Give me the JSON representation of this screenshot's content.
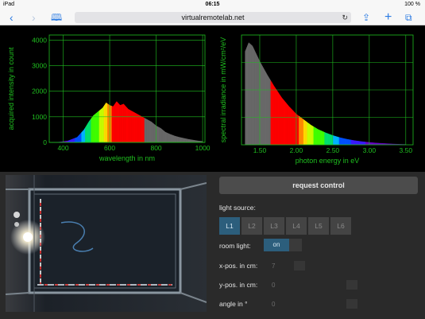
{
  "statusbar": {
    "device": "iPad",
    "wifi_icon": "wifi-icon",
    "time": "06:15",
    "battery": "100 %"
  },
  "browser": {
    "url": "virtualremotelab.net"
  },
  "chart_data": [
    {
      "type": "area",
      "xlabel": "wavelength in nm",
      "ylabel": "acquired intensity in count",
      "xlim": [
        340,
        1010
      ],
      "ylim": [
        0,
        4200
      ],
      "xticks": [
        "400",
        "600",
        "800",
        "1000"
      ],
      "yticks": [
        "0",
        "1000",
        "2000",
        "3000",
        "4000"
      ],
      "grid": true,
      "x": [
        350,
        380,
        420,
        460,
        490,
        510,
        530,
        550,
        570,
        585,
        600,
        615,
        630,
        645,
        660,
        680,
        700,
        720,
        740,
        760,
        780,
        800,
        820,
        840,
        860,
        880,
        900,
        920,
        940,
        960,
        980,
        1000
      ],
      "values": [
        0,
        10,
        60,
        200,
        500,
        800,
        1050,
        1200,
        1350,
        1550,
        1450,
        1400,
        1600,
        1450,
        1500,
        1300,
        1200,
        1100,
        1000,
        900,
        800,
        650,
        550,
        400,
        320,
        250,
        200,
        160,
        120,
        90,
        60,
        40
      ]
    },
    {
      "type": "area",
      "xlabel": "photon energy in eV",
      "ylabel": "spectral irradiance in mW/cm²/eV",
      "xlim": [
        1.25,
        3.6
      ],
      "ylim": [
        0,
        1
      ],
      "xticks": [
        "1.50",
        "2.00",
        "2.50",
        "3.00",
        "3.50"
      ],
      "grid": true,
      "x": [
        1.3,
        1.35,
        1.4,
        1.45,
        1.5,
        1.6,
        1.7,
        1.8,
        1.9,
        2.0,
        2.1,
        2.2,
        2.3,
        2.4,
        2.5,
        2.6,
        2.7,
        2.8,
        2.9,
        3.0,
        3.1,
        3.2,
        3.3,
        3.4,
        3.5
      ],
      "values": [
        0.85,
        0.93,
        0.9,
        0.83,
        0.76,
        0.64,
        0.53,
        0.43,
        0.35,
        0.28,
        0.23,
        0.18,
        0.14,
        0.11,
        0.085,
        0.065,
        0.05,
        0.038,
        0.029,
        0.022,
        0.016,
        0.012,
        0.008,
        0.005,
        0.003
      ]
    }
  ],
  "controls": {
    "request_label": "request control",
    "light_source_label": "light source:",
    "light_sources": [
      "L1",
      "L2",
      "L3",
      "L4",
      "L5",
      "L6"
    ],
    "active_source": "L1",
    "room_light_label": "room light:",
    "room_light_value": "on",
    "xpos_label": "x-pos. in cm:",
    "xpos_value": "7",
    "ypos_label": "y-pos. in cm:",
    "ypos_value": "0",
    "angle_label": "angle in °",
    "angle_value": "0"
  },
  "colors": {
    "accent": "#2c5e7c",
    "axis": "#1fbf1f",
    "browser_blue": "#2a7ae2"
  },
  "icons": [
    "back-icon",
    "forward-icon",
    "bookmarks-icon",
    "reload-icon",
    "share-icon",
    "add-tab-icon",
    "tabs-icon",
    "camera-view"
  ]
}
